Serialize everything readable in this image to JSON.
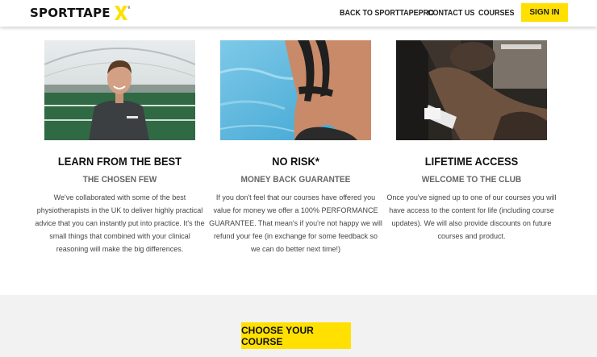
{
  "header": {
    "logo_text": "SPORTTAPE",
    "nav": [
      {
        "label": "BACK TO SPORTTAPEPRO"
      },
      {
        "label": "CONTACT US"
      },
      {
        "label": "COURSES"
      }
    ],
    "sign_in": "SIGN IN"
  },
  "features": [
    {
      "title": "LEARN FROM THE BEST",
      "subtitle": "THE CHOSEN FEW",
      "lines": [
        "We've collaborated with some of the best",
        "physiotherapists in the UK to deliver highly practical",
        "advice that you can instantly put into practice. It's the",
        "small things that combined with your clinical",
        "reasoning will make the big differences."
      ]
    },
    {
      "title": "NO RISK*",
      "subtitle": "MONEY BACK GUARANTEE",
      "lines": [
        "If you don't feel that our courses have offered you",
        "value for money we offer a 100% PERFORMANCE",
        "GUARANTEE. That mean's if you're not happy we will",
        "refund your fee (in exchange for some feedback so",
        "we can do better next time!)"
      ]
    },
    {
      "title": "LIFETIME ACCESS",
      "subtitle": "WELCOME TO THE CLUB",
      "lines": [
        "Once you've signed up to one of our courses you will",
        "have access to the content for life (including course",
        "updates). We will also provide discounts on future",
        "courses and product."
      ]
    }
  ],
  "cta": {
    "label": "CHOOSE YOUR COURSE"
  },
  "colors": {
    "accent": "#ffe000",
    "footer_bg": "#f2f2f2"
  }
}
